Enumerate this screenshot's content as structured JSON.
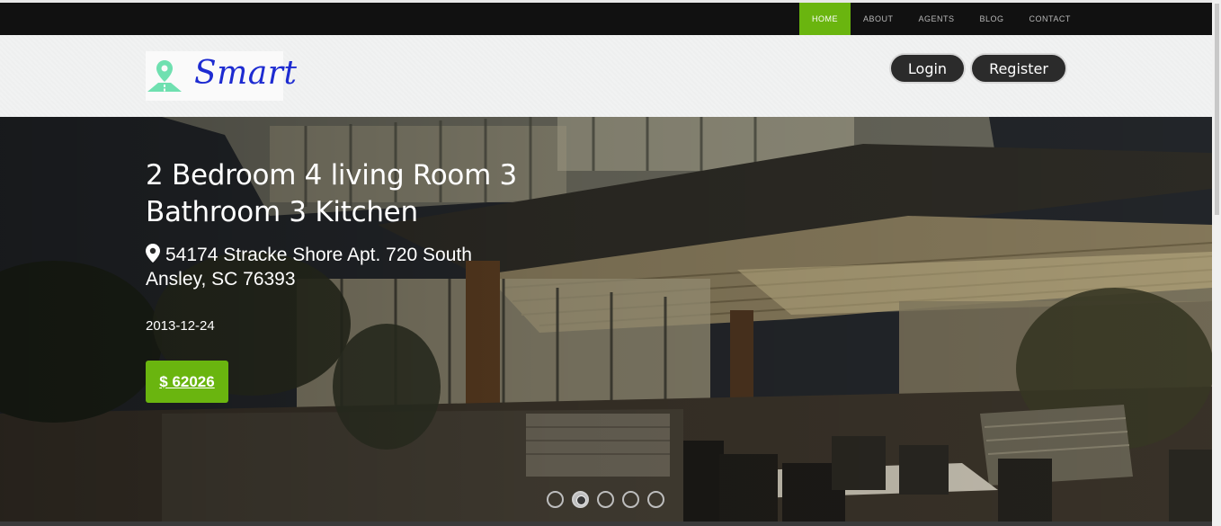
{
  "nav": {
    "items": [
      {
        "label": "HOME",
        "active": true
      },
      {
        "label": "ABOUT",
        "active": false
      },
      {
        "label": "AGENTS",
        "active": false
      },
      {
        "label": "BLOG",
        "active": false
      },
      {
        "label": "CONTACT",
        "active": false
      }
    ]
  },
  "header": {
    "logo_text": "Smart",
    "login_label": "Login",
    "register_label": "Register"
  },
  "hero": {
    "title": "2 Bedroom 4 living Room 3 Bathroom 3 Kitchen",
    "address": "54174 Stracke Shore Apt. 720 South Ansley, SC 76393",
    "date": "2013-12-24",
    "price": "$ 62026",
    "slides_total": 5,
    "active_slide": 2
  },
  "colors": {
    "accent": "#6ab50f",
    "topbar": "#111111",
    "logo_text": "#1d2bd1",
    "button_dark": "#2b2b2b"
  },
  "icons": {
    "logo": "map-pin-road-icon",
    "address": "map-pin-icon"
  }
}
